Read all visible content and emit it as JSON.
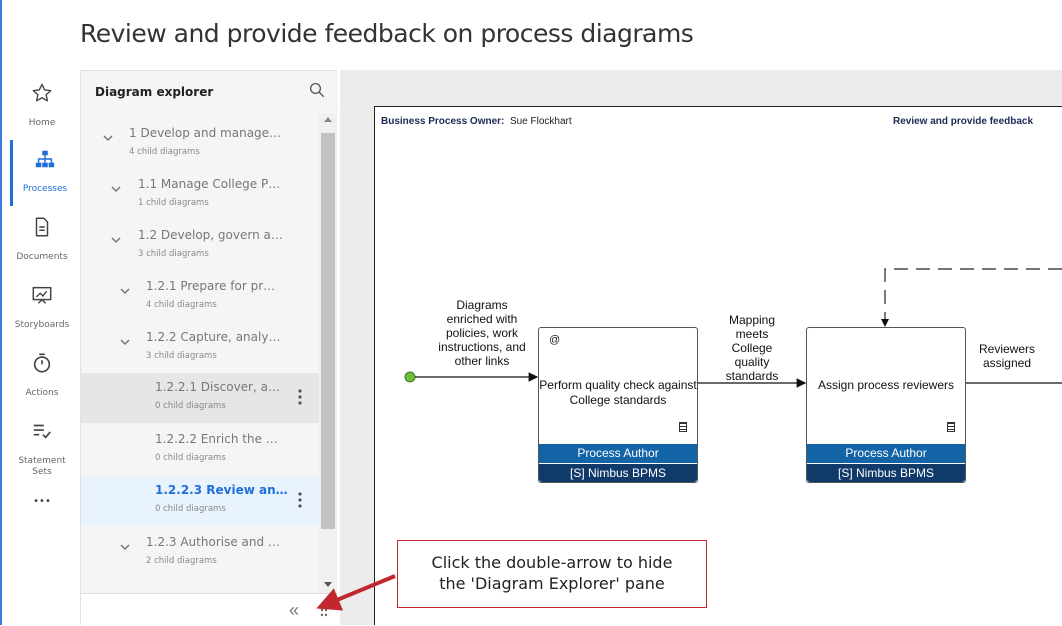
{
  "header": {
    "title": "Review and provide feedback on process diagrams",
    "caret": "-"
  },
  "nav": {
    "items": [
      {
        "label": "Home",
        "icon": "star-icon"
      },
      {
        "label": "Processes",
        "icon": "sitemap-icon",
        "active": true
      },
      {
        "label": "Documents",
        "icon": "document-icon"
      },
      {
        "label": "Storyboards",
        "icon": "presentation-icon"
      },
      {
        "label": "Actions",
        "icon": "stopwatch-icon"
      },
      {
        "label": "Statement Sets",
        "icon": "checklist-icon"
      },
      {
        "label": "•••",
        "icon": "more-icon"
      }
    ]
  },
  "explorer": {
    "title": "Diagram explorer",
    "collapse_glyph": "«",
    "items": [
      {
        "name": "1 Develop and manage…",
        "sub": "4 child diagrams"
      },
      {
        "name": "1.1 Manage College P…",
        "sub": "1 child diagrams"
      },
      {
        "name": "1.2 Develop, govern a…",
        "sub": "3 child diagrams"
      },
      {
        "name": "1.2.1 Prepare for pr…",
        "sub": "4 child diagrams"
      },
      {
        "name": "1.2.2 Capture, analy…",
        "sub": "3 child diagrams"
      },
      {
        "name": "1.2.2.1 Discover, a…",
        "sub": "0 child diagrams"
      },
      {
        "name": "1.2.2.2 Enrich the …",
        "sub": "0 child diagrams"
      },
      {
        "name": "1.2.2.3 Review an…",
        "sub": "0 child diagrams"
      },
      {
        "name": "1.2.3 Authorise and …",
        "sub": "2 child diagrams"
      }
    ]
  },
  "diagram": {
    "owner_label": "Business Process Owner:",
    "owner_name": "Sue Flockhart",
    "title": "Review and provide feedback",
    "input_label": "Diagrams enriched with policies, work instructions, and other links",
    "activity1": {
      "at": "@",
      "label": "Perform quality check against College standards",
      "role": "Process Author",
      "system": "[S] Nimbus BPMS"
    },
    "flow1_label": "Mapping meets College quality standards",
    "activity2": {
      "label": "Assign process reviewers",
      "role": "Process Author",
      "system": "[S] Nimbus BPMS"
    },
    "flow2_label": "Reviewers assigned"
  },
  "callout": {
    "line1": "Click the double-arrow to hide",
    "line2": "the 'Diagram Explorer' pane"
  },
  "colors": {
    "accent": "#1e6fd9",
    "role_bar": "#1464a8",
    "system_bar": "#0f3a6a",
    "callout_red": "#c0282d",
    "start_dot": "#6bbf3a"
  }
}
